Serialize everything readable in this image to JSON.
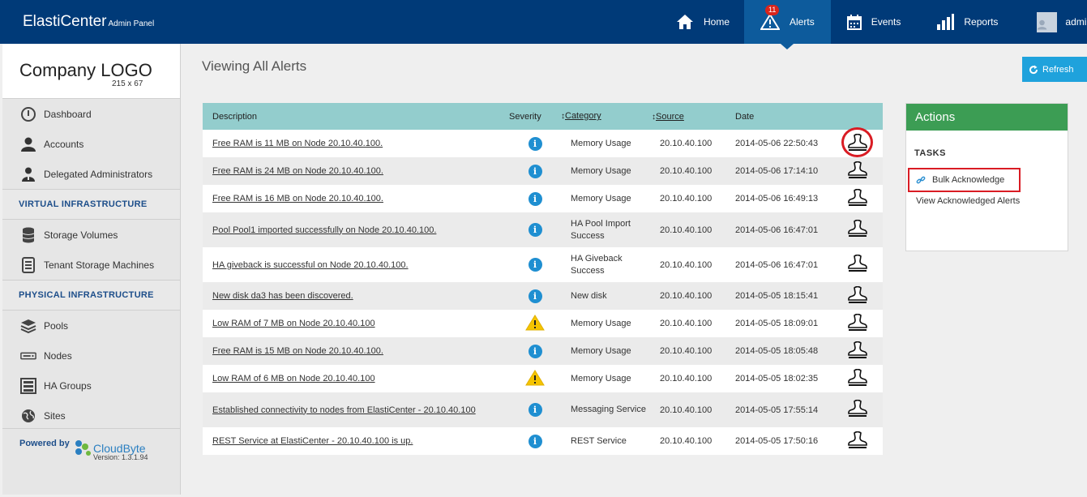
{
  "header": {
    "brand": "ElastiCenter",
    "brand_sub": "Admin Panel",
    "nav": [
      {
        "label": "Home",
        "icon": "home-icon"
      },
      {
        "label": "Alerts",
        "icon": "alert-icon",
        "badge": "11"
      },
      {
        "label": "Events",
        "icon": "calendar-icon"
      },
      {
        "label": "Reports",
        "icon": "bar-chart-icon"
      },
      {
        "label": "admin",
        "icon": "avatar-icon"
      }
    ]
  },
  "sidebar": {
    "logo_title": "Company LOGO",
    "logo_size": "215 x 67",
    "items_top": [
      {
        "label": "Dashboard",
        "icon": "gauge-icon"
      },
      {
        "label": "Accounts",
        "icon": "user-icon"
      },
      {
        "label": "Delegated Administrators",
        "icon": "admin-user-icon"
      }
    ],
    "section_virtual": "VIRTUAL INFRASTRUCTURE",
    "items_virtual": [
      {
        "label": "Storage Volumes",
        "icon": "database-icon"
      },
      {
        "label": "Tenant Storage Machines",
        "icon": "server-icon"
      }
    ],
    "section_physical": "PHYSICAL INFRASTRUCTURE",
    "items_physical": [
      {
        "label": "Pools",
        "icon": "layers-icon"
      },
      {
        "label": "Nodes",
        "icon": "node-icon"
      },
      {
        "label": "HA Groups",
        "icon": "rack-icon"
      },
      {
        "label": "Sites",
        "icon": "globe-icon"
      }
    ],
    "powered_by": "Powered by",
    "powered_brand": "CloudByte",
    "version": "Version: 1.3.1.94"
  },
  "main": {
    "title": "Viewing All Alerts",
    "refresh_label": "Refresh",
    "columns": [
      "Description",
      "Severity",
      "Category",
      "Source",
      "Date"
    ],
    "rows": [
      {
        "desc": "Free RAM is 11 MB on Node 20.10.40.100.",
        "sev": "info",
        "cat": "Memory Usage",
        "src": "20.10.40.100",
        "date": "2014-05-06 22:50:43"
      },
      {
        "desc": "Free RAM is 24 MB on Node 20.10.40.100.",
        "sev": "info",
        "cat": "Memory Usage",
        "src": "20.10.40.100",
        "date": "2014-05-06 17:14:10"
      },
      {
        "desc": "Free RAM is 16 MB on Node 20.10.40.100.",
        "sev": "info",
        "cat": "Memory Usage",
        "src": "20.10.40.100",
        "date": "2014-05-06 16:49:13"
      },
      {
        "desc": "Pool Pool1 imported successfully on Node 20.10.40.100.",
        "sev": "info",
        "cat": "HA Pool Import Success",
        "src": "20.10.40.100",
        "date": "2014-05-06 16:47:01"
      },
      {
        "desc": "HA giveback is successful on Node 20.10.40.100.",
        "sev": "info",
        "cat": "HA Giveback Success",
        "src": "20.10.40.100",
        "date": "2014-05-06 16:47:01"
      },
      {
        "desc": "New disk da3 has been discovered.",
        "sev": "info",
        "cat": "New disk",
        "src": "20.10.40.100",
        "date": "2014-05-05 18:15:41"
      },
      {
        "desc": "Low RAM of 7 MB on Node 20.10.40.100",
        "sev": "warning",
        "cat": "Memory Usage",
        "src": "20.10.40.100",
        "date": "2014-05-05 18:09:01"
      },
      {
        "desc": "Free RAM is 15 MB on Node 20.10.40.100.",
        "sev": "info",
        "cat": "Memory Usage",
        "src": "20.10.40.100",
        "date": "2014-05-05 18:05:48"
      },
      {
        "desc": "Low RAM of 6 MB on Node 20.10.40.100",
        "sev": "warning",
        "cat": "Memory Usage",
        "src": "20.10.40.100",
        "date": "2014-05-05 18:02:35"
      },
      {
        "desc": "Established connectivity to nodes from ElastiCenter - 20.10.40.100",
        "sev": "info",
        "cat": "Messaging Service",
        "src": "20.10.40.100",
        "date": "2014-05-05 17:55:14"
      },
      {
        "desc": "REST Service at ElastiCenter - 20.10.40.100 is up.",
        "sev": "info",
        "cat": "REST Service",
        "src": "20.10.40.100",
        "date": "2014-05-05 17:50:16"
      }
    ]
  },
  "actions": {
    "title": "Actions",
    "tasks_label": "TASKS",
    "bulk_ack": "Bulk Acknowledge",
    "view_ack": "View Acknowledged Alerts"
  },
  "colors": {
    "topbar": "#003a78",
    "active_nav": "#0d5b9c",
    "table_header": "#93cdcd",
    "actions_header": "#3c9d54",
    "refresh": "#1fa2dc",
    "highlight": "#d91c24"
  }
}
